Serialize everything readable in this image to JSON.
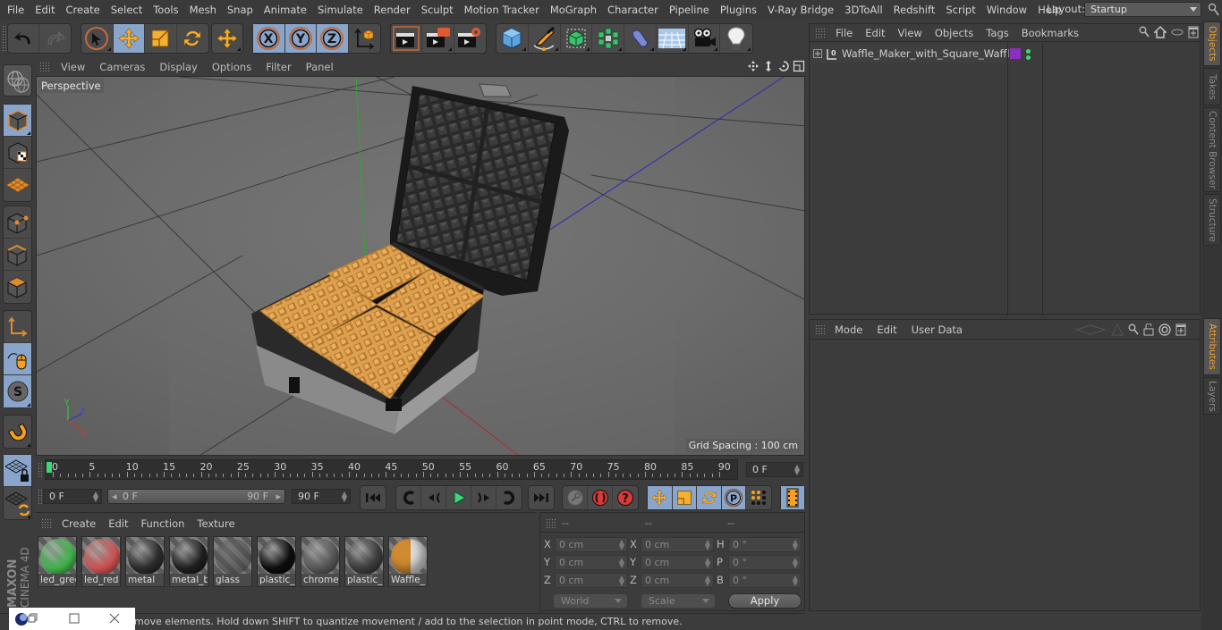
{
  "menubar": {
    "items": [
      "File",
      "Edit",
      "Create",
      "Select",
      "Tools",
      "Mesh",
      "Snap",
      "Animate",
      "Simulate",
      "Render",
      "Sculpt",
      "Motion Tracker",
      "MoGraph",
      "Character",
      "Pipeline",
      "Plugins",
      "V-Ray Bridge",
      "3DToAll",
      "Redshift",
      "Script",
      "Window",
      "Help"
    ],
    "layout_label": "Layout:",
    "layout_value": "Startup"
  },
  "toolbar": {
    "undo": "undo-icon",
    "redo": "redo-icon",
    "tools": [
      "live-selection",
      "move",
      "scale",
      "rotate",
      "last-tool"
    ],
    "axes": [
      "X",
      "Y",
      "Z"
    ],
    "render": [
      "render-view",
      "render-picture-viewer",
      "render-settings"
    ],
    "objects": [
      "cube",
      "pen-spline",
      "subdivision",
      "cloner",
      "deformer",
      "floor",
      "camera",
      "light"
    ]
  },
  "left_toolbar": {
    "items": [
      "model-mode",
      "texture-mode",
      "workplane-mode",
      "points-mode",
      "edges-mode",
      "polygons-mode",
      "axis-mode",
      "tweak-mode",
      "solo-mode",
      "snapping",
      "lock-workplane",
      "workplane-refresh"
    ]
  },
  "viewport": {
    "menu": [
      "View",
      "Cameras",
      "Display",
      "Options",
      "Filter",
      "Panel"
    ],
    "camera_label": "Perspective",
    "grid_spacing": "Grid Spacing : 100 cm",
    "axis_labels": {
      "x": "X",
      "y": "Y",
      "z": "Z"
    }
  },
  "timeline": {
    "ticks": [
      "0",
      "5",
      "10",
      "15",
      "20",
      "25",
      "30",
      "35",
      "40",
      "45",
      "50",
      "55",
      "60",
      "65",
      "70",
      "75",
      "80",
      "85",
      "90"
    ],
    "current_frame": "0 F",
    "start_field": "0 F",
    "range_start": "0 F",
    "range_end": "90 F",
    "end_field": "90 F"
  },
  "materials": {
    "menu": [
      "Create",
      "Edit",
      "Function",
      "Texture"
    ],
    "items": [
      {
        "name": "led_gree",
        "color": "#3fb04a"
      },
      {
        "name": "led_red",
        "color": "#c95050"
      },
      {
        "name": "metal",
        "color": "#2a2a2a"
      },
      {
        "name": "metal_b",
        "color": "#1e1e1e"
      },
      {
        "name": "glass",
        "color": "transparent"
      },
      {
        "name": "plastic_l",
        "color": "#0c0c0c"
      },
      {
        "name": "chrome",
        "color": "#555555"
      },
      {
        "name": "plastic_c",
        "color": "#3a3a3a"
      },
      {
        "name": "Waffle_",
        "color": "#d08a30"
      }
    ]
  },
  "coords": {
    "headers": [
      "--",
      "--",
      "--"
    ],
    "rows": [
      {
        "l1": "X",
        "v1": "0 cm",
        "l2": "X",
        "v2": "0 cm",
        "l3": "H",
        "v3": "0 °"
      },
      {
        "l1": "Y",
        "v1": "0 cm",
        "l2": "Y",
        "v2": "0 cm",
        "l3": "P",
        "v3": "0 °"
      },
      {
        "l1": "Z",
        "v1": "0 cm",
        "l2": "Z",
        "v2": "0 cm",
        "l3": "B",
        "v3": "0 °"
      }
    ],
    "space": "World",
    "mode": "Scale",
    "apply": "Apply"
  },
  "status": "move elements. Hold down SHIFT to quantize movement / add to the selection in point mode, CTRL to remove.",
  "objects_panel": {
    "menu": [
      "File",
      "Edit",
      "View",
      "Objects",
      "Tags",
      "Bookmarks"
    ],
    "object_name": "Waffle_Maker_with_Square_Waffle",
    "tag_color": "#8a2fc0",
    "dot_color": "#3cd877"
  },
  "attributes_panel": {
    "menu": [
      "Mode",
      "Edit",
      "User Data"
    ]
  },
  "right_tabs": {
    "top": [
      "Objects",
      "Takes",
      "Content Browser",
      "Structure"
    ],
    "bottom": [
      "Attributes",
      "Layers"
    ]
  },
  "branding": {
    "maxon": "MAXON",
    "product": "CINEMA 4D"
  },
  "colors": {
    "accent_orange": "#f0a030",
    "active_blue": "#8aa5cc",
    "playhead": "#3cd877"
  }
}
